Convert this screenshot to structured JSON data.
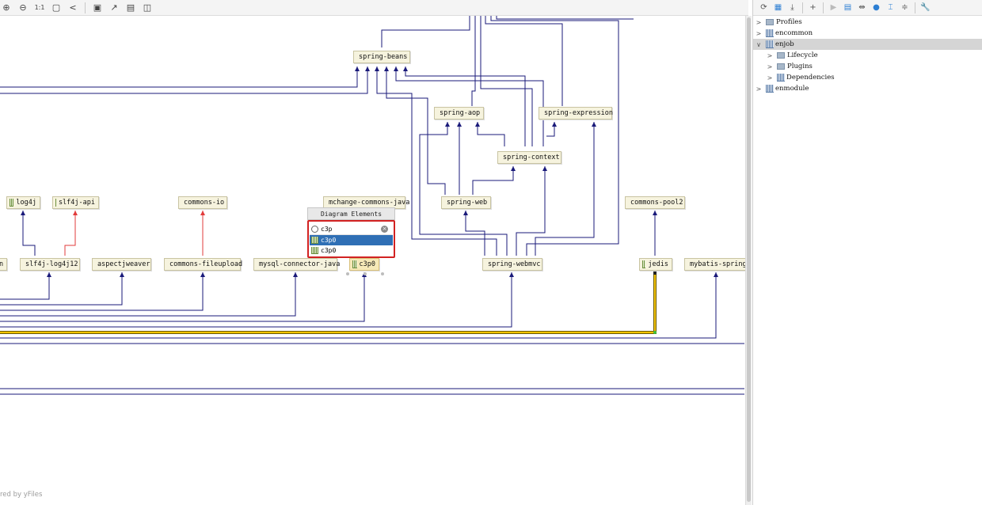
{
  "toolbar_left": {
    "icons": [
      "zoom-in-icon",
      "zoom-out-icon",
      "actual-size-icon",
      "fit-content-icon",
      "share-icon",
      "save-icon",
      "export-icon",
      "print-icon",
      "print-preview-icon"
    ],
    "actual_size_label": "1:1"
  },
  "nodes": {
    "spring_beans": "spring-beans",
    "spring_aop": "spring-aop",
    "spring_expression": "spring-expression",
    "spring_context": "spring-context",
    "log4j": "log4j",
    "slf4j_api": "slf4j-api",
    "commons_io": "commons-io",
    "mchange_commons_java": "mchange-commons-java",
    "spring_web": "spring-web",
    "commons_pool2": "commons-pool2",
    "partial_left": "n",
    "slf4j_log4j12": "slf4j-log4j12",
    "aspectjweaver": "aspectjweaver",
    "commons_fileupload": "commons-fileupload",
    "mysql_connector_java": "mysql-connector-java",
    "c3p0": "c3p0",
    "spring_webmvc": "spring-webmvc",
    "jedis": "jedis",
    "mybatis_spring": "mybatis-spring"
  },
  "popup": {
    "title": "Diagram Elements",
    "search_value": "c3p",
    "results": [
      "c3p0",
      "c3p0"
    ]
  },
  "watermark": "red by yFiles",
  "colors": {
    "edge": "#1a1a7a",
    "conflict_edge": "#e23b3b",
    "highlight_edge": "#e8b800",
    "selection": "#2f6fb5"
  },
  "tree": [
    {
      "label": "Profiles",
      "expanded": false,
      "selected": false,
      "icon": "profiles-icon"
    },
    {
      "label": "encommon",
      "expanded": false,
      "selected": false,
      "icon": "module-icon"
    },
    {
      "label": "enjob",
      "expanded": true,
      "selected": true,
      "icon": "module-icon"
    },
    {
      "label": "Lifecycle",
      "expanded": false,
      "selected": false,
      "icon": "lifecycle-icon"
    },
    {
      "label": "Plugins",
      "expanded": false,
      "selected": false,
      "icon": "plugins-icon"
    },
    {
      "label": "Dependencies",
      "expanded": false,
      "selected": false,
      "icon": "dependencies-icon"
    },
    {
      "label": "enmodule",
      "expanded": false,
      "selected": false,
      "icon": "module-icon"
    }
  ],
  "toolbar_right": {
    "icons": [
      "reload-icon",
      "add-folder-icon",
      "download-icon",
      "add-icon",
      "run-icon",
      "run-config-icon",
      "toggle-offline-icon",
      "skip-tests-icon",
      "show-diagram-icon",
      "collapse-icon",
      "settings-wrench-icon"
    ]
  }
}
